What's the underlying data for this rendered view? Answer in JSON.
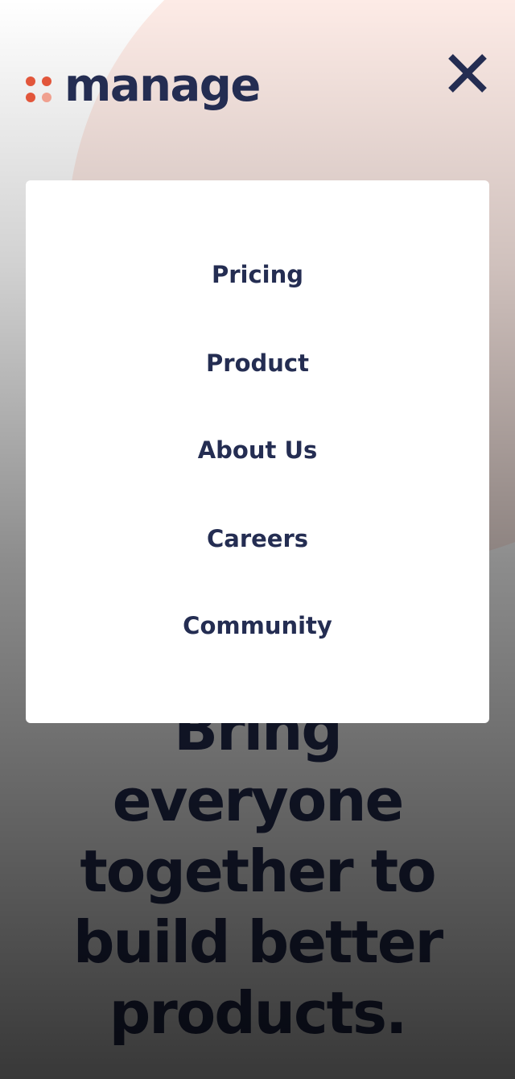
{
  "header": {
    "logo_text": "manage",
    "logo_icon": "four-dots-logo-mark",
    "close_icon": "close-x-icon"
  },
  "menu": {
    "items": [
      {
        "label": "Pricing"
      },
      {
        "label": "Product"
      },
      {
        "label": "About Us"
      },
      {
        "label": "Careers"
      },
      {
        "label": "Community"
      }
    ]
  },
  "hero": {
    "lines": [
      "Bring",
      "everyone",
      "together to",
      "build better",
      "products."
    ]
  },
  "colors": {
    "brand_navy": "#242d52",
    "accent_orange": "#e2563b",
    "accent_light": "#f0a08f",
    "blob_pink": "#fdebe6",
    "panel_white": "#ffffff"
  }
}
